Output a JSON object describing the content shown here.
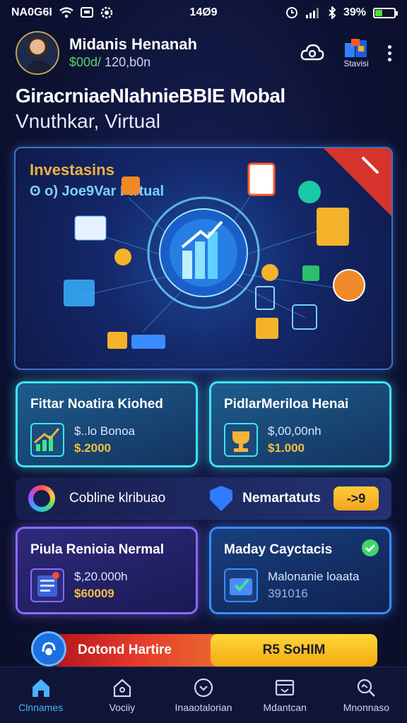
{
  "status": {
    "carrier": "NA0G6I",
    "time": "14Ø9",
    "battery": "39%",
    "battery_level": 0.39
  },
  "header": {
    "name": "Midanis Henanah",
    "balance_prefix": "$00d/",
    "balance_rest": " 120,b0n",
    "right_label": "Stavisi"
  },
  "titles": {
    "line1": "GiracrniaeNlahnieBBlE Mobal",
    "line2": "Vnuthkar, Virtual"
  },
  "hero": {
    "title": "Investasins",
    "subtitle": "ʘ o) Joe9Var   Pirtual"
  },
  "cards": [
    {
      "title": "Fittar Noatira Kiohed",
      "line1": "$..lo Bonoa",
      "line2": "$.2000"
    },
    {
      "title": "PidlarMeriloa Henai",
      "line1": "$,00,00nh",
      "line2": "$1.000"
    },
    {
      "title": "Piula Renioia Nermal",
      "line1": "$,20.000h",
      "line2": "$60009"
    },
    {
      "title": "Maday Cayctacis",
      "line1": "Malonanie loaata",
      "line2": "391016"
    }
  ],
  "promo": {
    "left_label": "Cobline klribuao",
    "right_label": "Nemartatuts",
    "button": "->9"
  },
  "actions": {
    "left": "Dotond Hartire",
    "right": "R5 SoHIM"
  },
  "nav": [
    {
      "label": "Clnnames",
      "icon": "home-icon"
    },
    {
      "label": "Vociiy",
      "icon": "house-outline-icon"
    },
    {
      "label": "Inaaotalorian",
      "icon": "search-circle-icon"
    },
    {
      "label": "Mdantcan",
      "icon": "inbox-icon"
    },
    {
      "label": "Mnonnaso",
      "icon": "search-icon"
    }
  ],
  "colors": {
    "accent": "#3ee4f2",
    "gold": "#f5c042",
    "red": "#e53a2c",
    "active_nav": "#4ab0ff"
  }
}
